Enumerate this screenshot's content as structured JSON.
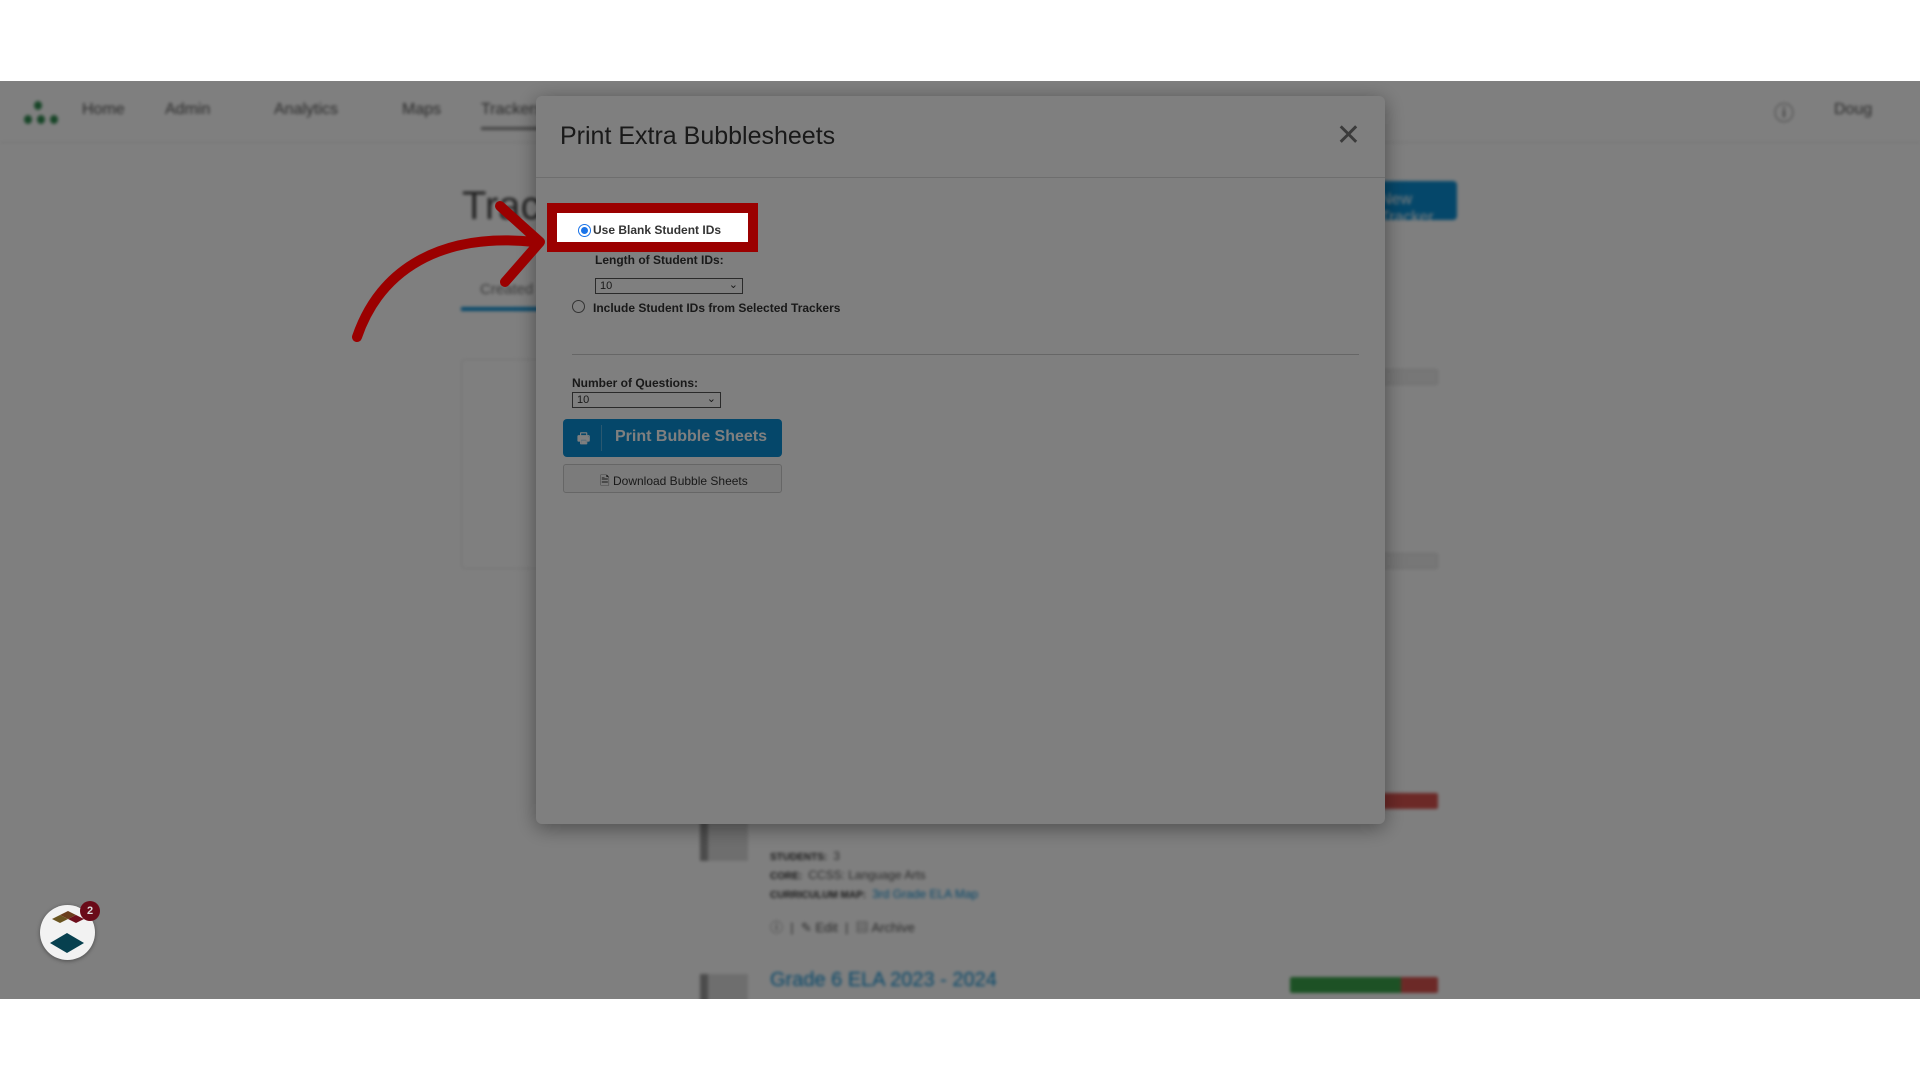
{
  "nav": {
    "items": [
      "Home",
      "Admin",
      "Analytics",
      "Maps",
      "Trackers"
    ],
    "user": "Doug"
  },
  "page": {
    "title": "Trackers",
    "tab": "Created",
    "new_button": "New Tracker",
    "tracker": {
      "students_label": "STUDENTS:",
      "students": "3",
      "core_label": "CORE:",
      "core": "CCSS: Language Arts",
      "map_label": "CURRICULUM MAP:",
      "map": "3rd Grade ELA Map",
      "edit": "Edit",
      "archive": "Archive"
    },
    "next_tracker": "Grade 6 ELA 2023 - 2024"
  },
  "modal": {
    "title": "Print Extra Bubblesheets",
    "option_blank": "Use Blank Student IDs",
    "option_blank_selected": true,
    "length_label": "Length of Student IDs:",
    "length_value": "10",
    "option_include": "Include Student IDs from Selected Trackers",
    "questions_label": "Number of Questions:",
    "questions_value": "10",
    "print_button": "Print Bubble Sheets",
    "download_button": "Download Bubble Sheets"
  },
  "widget": {
    "badge": "2"
  },
  "colors": {
    "accent": "#0b8fd4",
    "highlight": "#9b0000"
  }
}
